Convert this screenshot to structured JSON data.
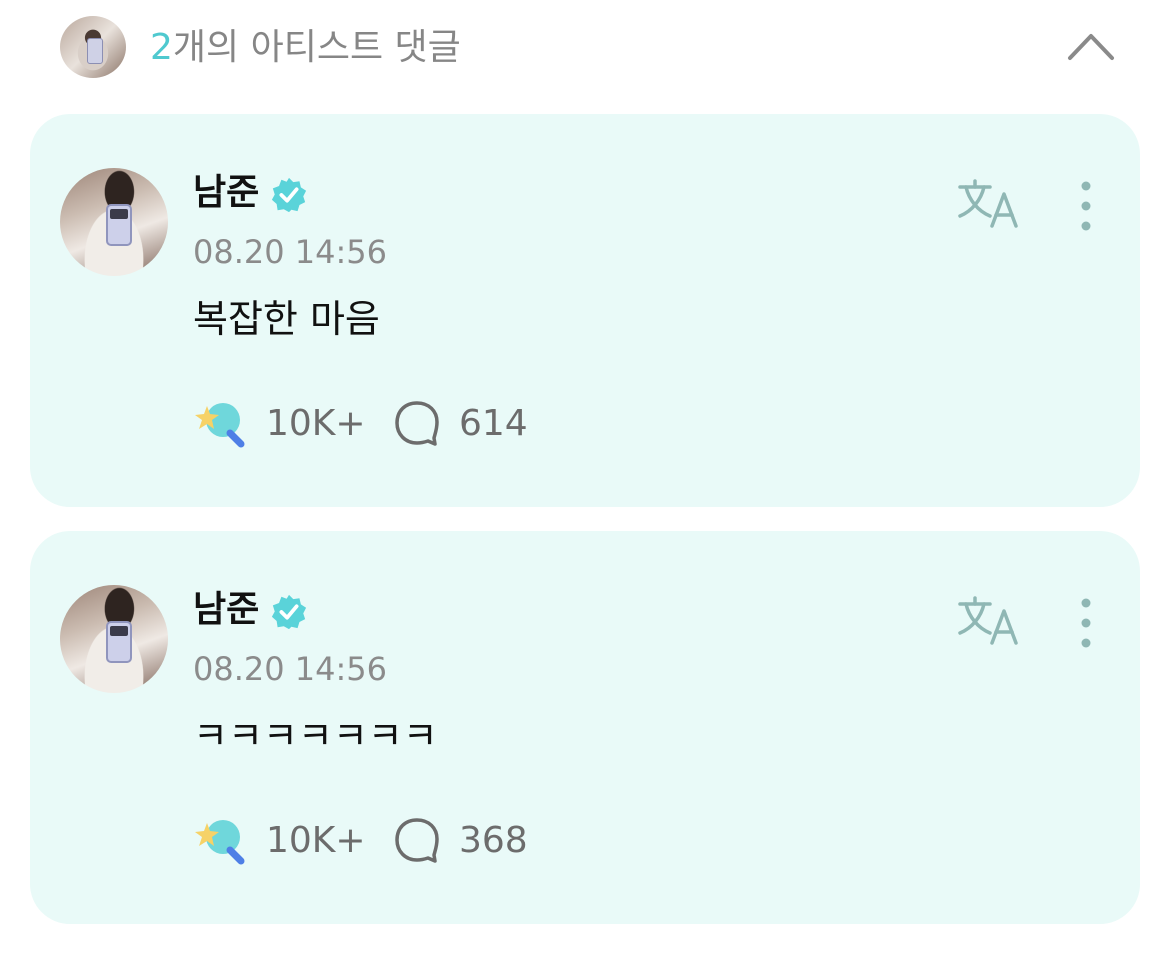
{
  "header": {
    "count": "2",
    "title_rest": "개의 아티스트 댓글"
  },
  "comments": [
    {
      "author": "남준",
      "time": "08.20 14:56",
      "text": "복잡한 마음",
      "reactions": "10K+",
      "replies": "614"
    },
    {
      "author": "남준",
      "time": "08.20 14:56",
      "text": "ㅋㅋㅋㅋㅋㅋㅋ",
      "reactions": "10K+",
      "replies": "368"
    }
  ],
  "colors": {
    "accent": "#4fc9cf",
    "card_bg": "#e9faf8",
    "muted": "#868686"
  },
  "icons": {
    "collapse": "chevron-up-icon",
    "verified": "verified-badge-icon",
    "translate": "translate-icon",
    "more": "more-vertical-icon",
    "reaction": "lightstick-reaction-icon",
    "comment": "comment-bubble-icon"
  }
}
